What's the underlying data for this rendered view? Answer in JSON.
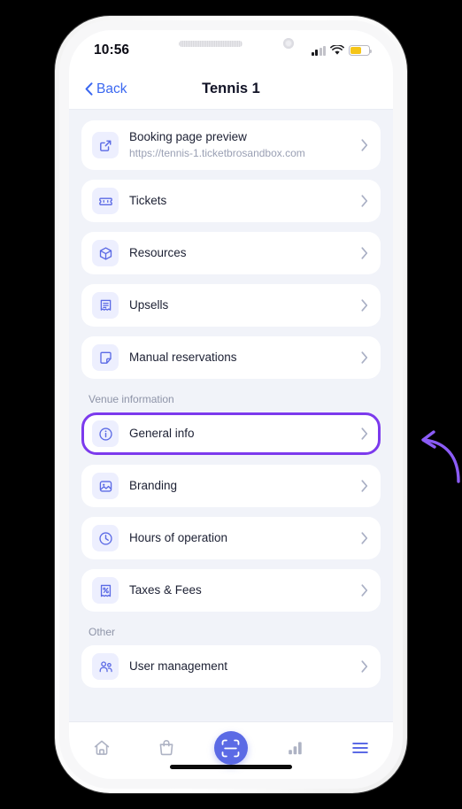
{
  "status_bar": {
    "time": "10:56",
    "signal_icon": "cellular-bars-icon",
    "wifi_icon": "wifi-icon",
    "battery_icon": "battery-icon"
  },
  "navbar": {
    "back_label": "Back",
    "back_icon": "chevron-left-icon",
    "title": "Tennis 1"
  },
  "groups": [
    {
      "header": null,
      "items": [
        {
          "label": "Booking page preview",
          "sublabel": "https://tennis-1.ticketbrosandbox.com",
          "icon": "external-link-icon",
          "highlighted": false
        }
      ]
    },
    {
      "header": null,
      "items": [
        {
          "label": "Tickets",
          "sublabel": null,
          "icon": "ticket-icon",
          "highlighted": false
        },
        {
          "label": "Resources",
          "sublabel": null,
          "icon": "cube-icon",
          "highlighted": false
        },
        {
          "label": "Upsells",
          "sublabel": null,
          "icon": "receipt-icon",
          "highlighted": false
        },
        {
          "label": "Manual reservations",
          "sublabel": null,
          "icon": "note-icon",
          "highlighted": false
        }
      ]
    },
    {
      "header": "Venue information",
      "items": [
        {
          "label": "General info",
          "sublabel": null,
          "icon": "info-circle-icon",
          "highlighted": true
        },
        {
          "label": "Branding",
          "sublabel": null,
          "icon": "image-icon",
          "highlighted": false
        },
        {
          "label": "Hours of operation",
          "sublabel": null,
          "icon": "clock-icon",
          "highlighted": false
        },
        {
          "label": "Taxes & Fees",
          "sublabel": null,
          "icon": "tax-receipt-icon",
          "highlighted": false
        }
      ]
    },
    {
      "header": "Other",
      "items": [
        {
          "label": "User management",
          "sublabel": null,
          "icon": "users-icon",
          "highlighted": false
        }
      ]
    }
  ],
  "tabbar": {
    "tabs": [
      {
        "name": "home",
        "icon": "home-icon",
        "active": false
      },
      {
        "name": "orders",
        "icon": "shopping-bag-icon",
        "active": false
      },
      {
        "name": "scan",
        "icon": "scan-icon",
        "active": true
      },
      {
        "name": "reports",
        "icon": "bar-chart-icon",
        "active": false
      },
      {
        "name": "menu",
        "icon": "hamburger-menu-icon",
        "active": false
      }
    ]
  },
  "annotation": {
    "arrow_icon": "curved-arrow-left-icon",
    "color": "#8B5CF6"
  },
  "colors": {
    "accent": "#5B6AE5",
    "highlight": "#7C3AED",
    "page_bg": "#F1F3F9",
    "card_bg": "#FFFFFF",
    "icon_badge_bg": "#EDEFFE",
    "text_primary": "#1C2033",
    "text_muted": "#9AA0B4",
    "link": "#3B68F0",
    "battery": "#F5C518"
  }
}
